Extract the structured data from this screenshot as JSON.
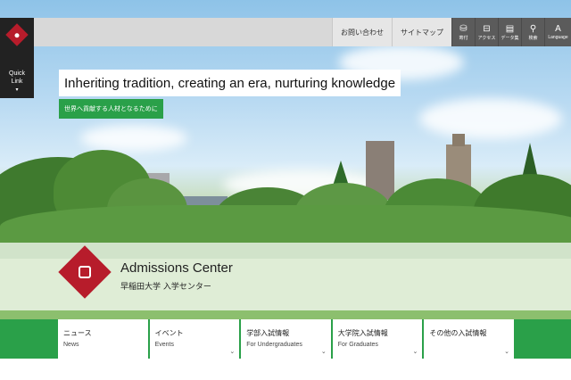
{
  "quick_link": {
    "label_line1": "Quick",
    "label_line2": "Link",
    "arrow": "▾"
  },
  "topbar": {
    "contact": "お問い合わせ",
    "sitemap": "サイトマップ",
    "icons": [
      {
        "name": "donation-icon",
        "glyph": "⛁",
        "label": "寄付"
      },
      {
        "name": "access-icon",
        "glyph": "⊟",
        "label": "アクセス"
      },
      {
        "name": "data-collection-icon",
        "glyph": "▤",
        "label": "データ集"
      },
      {
        "name": "search-icon",
        "glyph": "⚲",
        "label": "検索"
      },
      {
        "name": "language-icon",
        "glyph": "A",
        "label": "Language"
      }
    ]
  },
  "hero": {
    "tagline": "Inheriting tradition, creating an era, nurturing knowledge",
    "sub_tagline": "世界へ貢献する人材となるために"
  },
  "admissions": {
    "title": "Admissions Center",
    "subtitle": "早稲田大学 入学センター"
  },
  "nav": {
    "items": [
      {
        "jp": "ニュース",
        "en": "News",
        "chevron": ""
      },
      {
        "jp": "イベント",
        "en": "Events",
        "chevron": "⌄"
      },
      {
        "jp": "学部入試情報",
        "en": "For Undergraduates",
        "chevron": "⌄"
      },
      {
        "jp": "大学院入試情報",
        "en": "For Graduates",
        "chevron": "⌄"
      },
      {
        "jp": "その他の入試情報",
        "en": "",
        "chevron": "⌄"
      }
    ]
  },
  "colors": {
    "brand_red": "#b71c2b",
    "accent_green": "#2aa049",
    "dark_panel": "#222222",
    "icon_panel": "#5b5b5b"
  }
}
